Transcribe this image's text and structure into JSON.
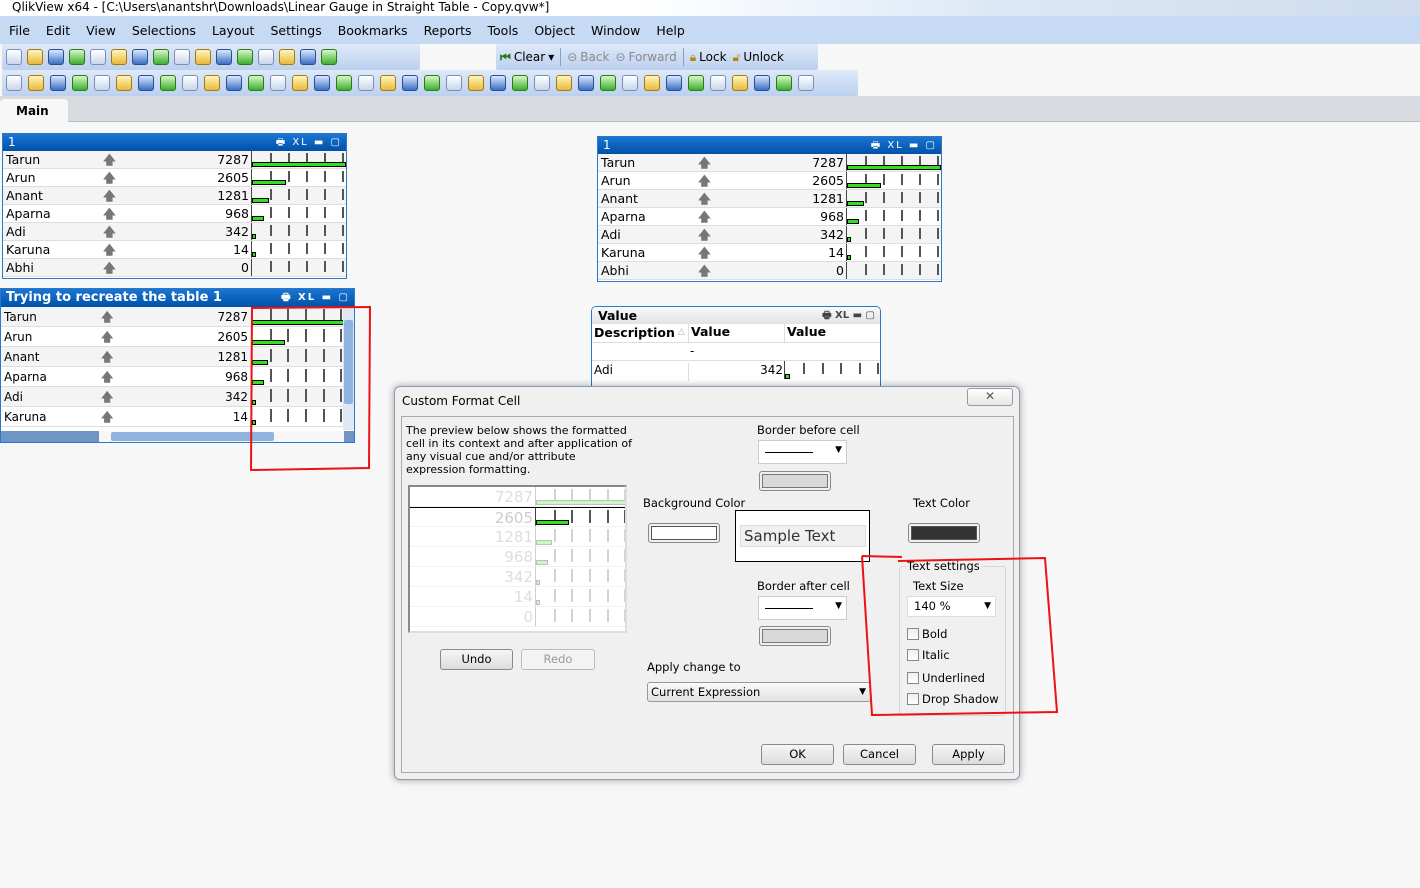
{
  "window": {
    "title": "QlikView x64 - [C:\\Users\\anantshr\\Downloads\\Linear Gauge in Straight Table - Copy.qvw*]"
  },
  "menu": [
    "File",
    "Edit",
    "View",
    "Selections",
    "Layout",
    "Settings",
    "Bookmarks",
    "Reports",
    "Tools",
    "Object",
    "Window",
    "Help"
  ],
  "toolbar1": {
    "icons": [
      "new-icon",
      "open-icon",
      "reload-icon",
      "save-icon",
      "print-icon",
      "edit-script-icon",
      "reload-data-icon",
      "undo-icon",
      "redo-icon",
      "search-icon",
      "check-icon",
      "chart-wizard-icon",
      "favorite-icon",
      "edit-icon",
      "help-icon",
      "context-help-icon"
    ],
    "clear": "Clear",
    "back": "Back",
    "forward": "Forward",
    "lock": "Lock",
    "unlock": "Unlock"
  },
  "toolbar2": {
    "icons": [
      "new-sheet-icon",
      "move-left-icon",
      "move-right-icon",
      "sheet-properties-icon",
      "listbox-icon",
      "statistics-box-icon",
      "table-box-icon",
      "multibox-icon",
      "chart-icon",
      "input-box-icon",
      "current-selections-icon",
      "button-icon",
      "text-object-icon",
      "line-arrow-icon",
      "slider-icon",
      "bookmark-object-icon",
      "search-object-icon",
      "container-icon",
      "custom-object-icon",
      "chart-wizard-icon",
      "format-painter-icon",
      "align-icon",
      "align-left-icon",
      "center-h-icon",
      "align-right-icon",
      "align-bottom-icon",
      "center-v-icon",
      "align-top-icon",
      "space-h-icon",
      "space-v-icon",
      "adjust-left-icon",
      "adjust-top-icon",
      "server-object-icon",
      "new-server-object-icon",
      "edit-server-object-icon",
      "share-icon",
      "document-icon"
    ]
  },
  "tabs": [
    {
      "label": "Main"
    }
  ],
  "accent": "#0a5fbf",
  "gauge_color": "#33dd22",
  "tables": {
    "t1": {
      "title": "1",
      "rows": [
        {
          "name": "Tarun",
          "value": 7287
        },
        {
          "name": "Arun",
          "value": 2605
        },
        {
          "name": "Anant",
          "value": 1281
        },
        {
          "name": "Aparna",
          "value": 968
        },
        {
          "name": "Adi",
          "value": 342
        },
        {
          "name": "Karuna",
          "value": 14
        },
        {
          "name": "Abhi",
          "value": 0
        }
      ]
    },
    "t2": {
      "title": "Trying to recreate the table 1",
      "rows": [
        {
          "name": "Tarun",
          "value": 7287
        },
        {
          "name": "Arun",
          "value": 2605
        },
        {
          "name": "Anant",
          "value": 1281
        },
        {
          "name": "Aparna",
          "value": 968
        },
        {
          "name": "Adi",
          "value": 342
        },
        {
          "name": "Karuna",
          "value": 14
        }
      ]
    },
    "t3": {
      "title": "1",
      "rows": [
        {
          "name": "Tarun",
          "value": 7287
        },
        {
          "name": "Arun",
          "value": 2605
        },
        {
          "name": "Anant",
          "value": 1281
        },
        {
          "name": "Aparna",
          "value": 968
        },
        {
          "name": "Adi",
          "value": 342
        },
        {
          "name": "Karuna",
          "value": 14
        },
        {
          "name": "Abhi",
          "value": 0
        }
      ]
    },
    "t4": {
      "title": "Value",
      "columns": [
        "Description",
        "Value",
        "Value"
      ],
      "total": "-",
      "rows": [
        {
          "name": "Adi",
          "value": 342
        }
      ]
    }
  },
  "gauge_max": 7287,
  "dialog": {
    "title": "Custom Format Cell",
    "description": "The preview below shows the formatted cell in its context and after application of any visual cue and/or attribute expression formatting.",
    "preview_values": [
      7287,
      2605,
      1281,
      968,
      342,
      14,
      0
    ],
    "border_before": "Border before cell",
    "border_after": "Border after cell",
    "background_color": "Background Color",
    "text_color": "Text Color",
    "sample_text": "Sample Text",
    "text_settings": "Text settings",
    "text_size_label": "Text Size",
    "text_size": "140 %",
    "checkboxes": [
      {
        "label": "Bold",
        "checked": false
      },
      {
        "label": "Italic",
        "checked": false
      },
      {
        "label": "Underlined",
        "checked": false
      },
      {
        "label": "Drop Shadow",
        "checked": false
      }
    ],
    "apply_change_to": "Apply change to",
    "apply_target": "Current Expression",
    "undo": "Undo",
    "redo": "Redo",
    "ok": "OK",
    "cancel": "Cancel",
    "apply": "Apply",
    "text_color_value": "#333333",
    "background_color_value": "#ffffff"
  }
}
